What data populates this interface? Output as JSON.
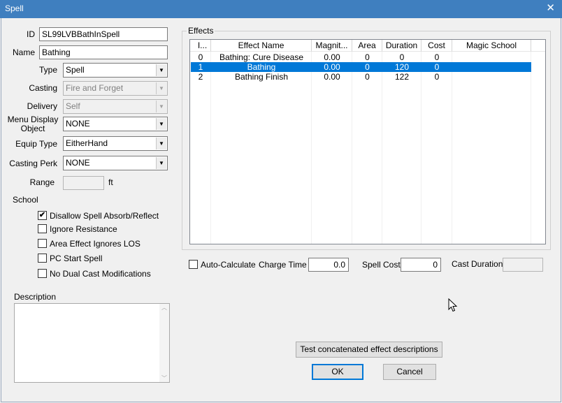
{
  "window": {
    "title": "Spell",
    "close_glyph": "✕"
  },
  "form": {
    "id_label": "ID",
    "id_value": "SL99LVBBathInSpell",
    "name_label": "Name",
    "name_value": "Bathing",
    "type_label": "Type",
    "type_value": "Spell",
    "casting_label": "Casting",
    "casting_value": "Fire and Forget",
    "delivery_label": "Delivery",
    "delivery_value": "Self",
    "menu_display_label_1": "Menu Display",
    "menu_display_label_2": "Object",
    "menu_display_value": "NONE",
    "equip_type_label": "Equip Type",
    "equip_type_value": "EitherHand",
    "casting_perk_label": "Casting Perk",
    "casting_perk_value": "NONE",
    "range_label": "Range",
    "range_value": "",
    "range_unit": "ft"
  },
  "school": {
    "label": "School",
    "options": [
      {
        "label": "Disallow Spell Absorb/Reflect",
        "checked": true
      },
      {
        "label": "Ignore Resistance",
        "checked": false
      },
      {
        "label": "Area Effect Ignores LOS",
        "checked": false
      },
      {
        "label": "PC Start Spell",
        "checked": false
      },
      {
        "label": "No Dual Cast Modifications",
        "checked": false
      }
    ]
  },
  "description": {
    "label": "Description",
    "value": ""
  },
  "effects": {
    "label": "Effects",
    "columns": [
      "I...",
      "Effect Name",
      "Magnit...",
      "Area",
      "Duration",
      "Cost",
      "Magic School"
    ],
    "rows": [
      {
        "index": "0",
        "name": "Bathing: Cure Disease",
        "magnitude": "0.00",
        "area": "0",
        "duration": "0",
        "cost": "0",
        "school": "",
        "selected": false
      },
      {
        "index": "1",
        "name": "Bathing",
        "magnitude": "0.00",
        "area": "0",
        "duration": "120",
        "cost": "0",
        "school": "",
        "selected": true
      },
      {
        "index": "2",
        "name": "Bathing Finish",
        "magnitude": "0.00",
        "area": "0",
        "duration": "122",
        "cost": "0",
        "school": "",
        "selected": false
      }
    ]
  },
  "costs": {
    "auto_calculate_label": "Auto-Calculate",
    "auto_calculate_checked": false,
    "charge_time_label": "Charge Time",
    "charge_time_value": "0.0",
    "spell_cost_label": "Spell Cost",
    "spell_cost_value": "0",
    "cast_duration_label": "Cast Duration",
    "cast_duration_value": ""
  },
  "buttons": {
    "test_descriptions": "Test concatenated effect descriptions",
    "ok": "OK",
    "cancel": "Cancel"
  },
  "colors": {
    "titlebar": "#3f7fbf",
    "selection": "#0078d7"
  }
}
